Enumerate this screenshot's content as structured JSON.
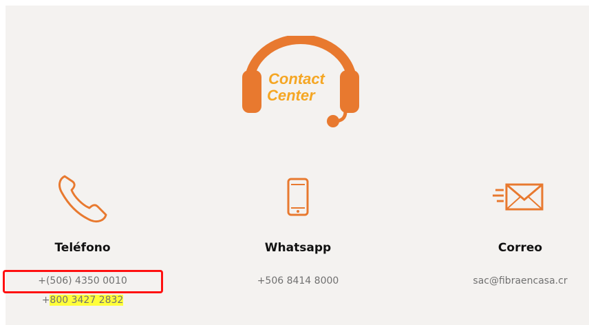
{
  "logo": {
    "line1": "Contact",
    "line2": "Center"
  },
  "contacts": [
    {
      "title": "Teléfono",
      "lines": [
        "+(506) 4350 0010",
        "+",
        "800 3427 2832"
      ]
    },
    {
      "title": "Whatsapp",
      "lines": [
        "+506 8414 8000"
      ]
    },
    {
      "title": "Correo",
      "lines": [
        "sac@fibraencasa.cr"
      ]
    }
  ],
  "colors": {
    "accent": "#e8792f",
    "logo_text": "#f5a623",
    "background": "#f4f2f0",
    "highlight": "#ffff3a",
    "annotation_box": "#ff1010"
  },
  "icons": {
    "logo": "headset-icon",
    "phone": "phone-icon",
    "whatsapp": "mobile-phone-icon",
    "email": "envelope-icon"
  }
}
